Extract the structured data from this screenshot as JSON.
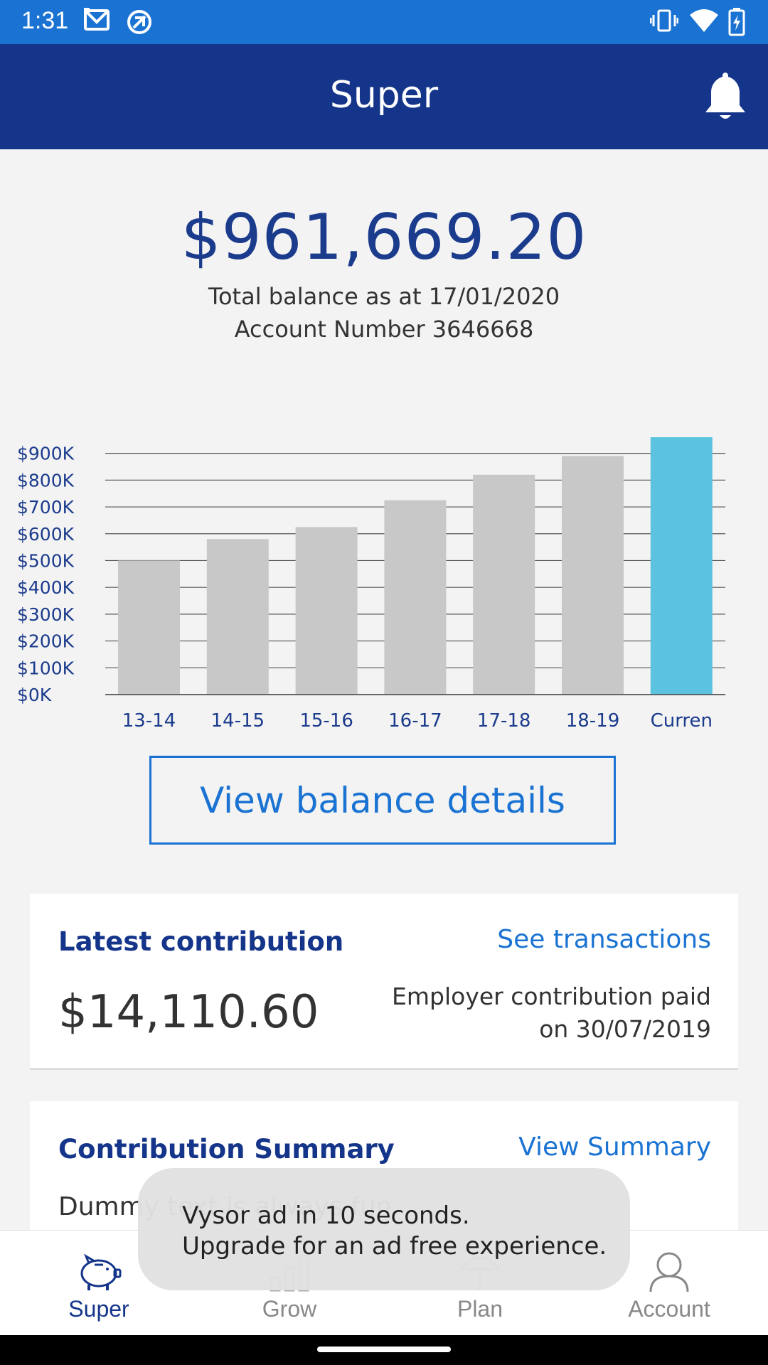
{
  "status_bar": {
    "time": "1:31",
    "icons": [
      "gmail-icon",
      "sync-icon",
      "vibrate-icon",
      "wifi-icon",
      "battery-charging-icon"
    ]
  },
  "header": {
    "title": "Super",
    "icon": "bell-icon"
  },
  "balance": {
    "amount": "$961,669.20",
    "as_at": "Total balance as at 17/01/2020",
    "account": "Account Number 3646668"
  },
  "chart_data": {
    "type": "bar",
    "categories": [
      "13-14",
      "14-15",
      "15-16",
      "16-17",
      "17-18",
      "18-19",
      "Curren"
    ],
    "values": [
      500,
      580,
      625,
      725,
      820,
      890,
      960
    ],
    "ylim": [
      0,
      960
    ],
    "yticks": [
      "$0K",
      "$100K",
      "$200K",
      "$300K",
      "$400K",
      "$500K",
      "$600K",
      "$700K",
      "$800K",
      "$900K"
    ],
    "ytick_values": [
      0,
      100,
      200,
      300,
      400,
      500,
      600,
      700,
      800,
      900
    ],
    "grid": true,
    "colors": {
      "bar": "#c8c8c8",
      "highlight": "#5bc3e0",
      "axis_text": "#1b3b8c"
    }
  },
  "actions": {
    "view_balance": "View balance details"
  },
  "latest_contribution": {
    "title": "Latest contribution",
    "link": "See transactions",
    "amount": "$14,110.60",
    "desc_line1": "Employer contribution paid",
    "desc_line2": "on 30/07/2019"
  },
  "contribution_summary": {
    "title": "Contribution Summary",
    "link": "View Summary",
    "text": "Dummy text is always fun"
  },
  "toast": {
    "line1": "Vysor ad in 10 seconds.",
    "line2": "Upgrade for an ad free experience."
  },
  "bottom_nav": [
    {
      "label": "Super",
      "icon": "piggy-bank-icon",
      "active": true
    },
    {
      "label": "Grow",
      "icon": "bar-chart-icon",
      "active": false
    },
    {
      "label": "Plan",
      "icon": "umbrella-icon",
      "active": false
    },
    {
      "label": "Account",
      "icon": "person-icon",
      "active": false
    }
  ],
  "colors": {
    "primary": "#14358a",
    "status_bar": "#1a73d2",
    "accent": "#1a73d2"
  }
}
